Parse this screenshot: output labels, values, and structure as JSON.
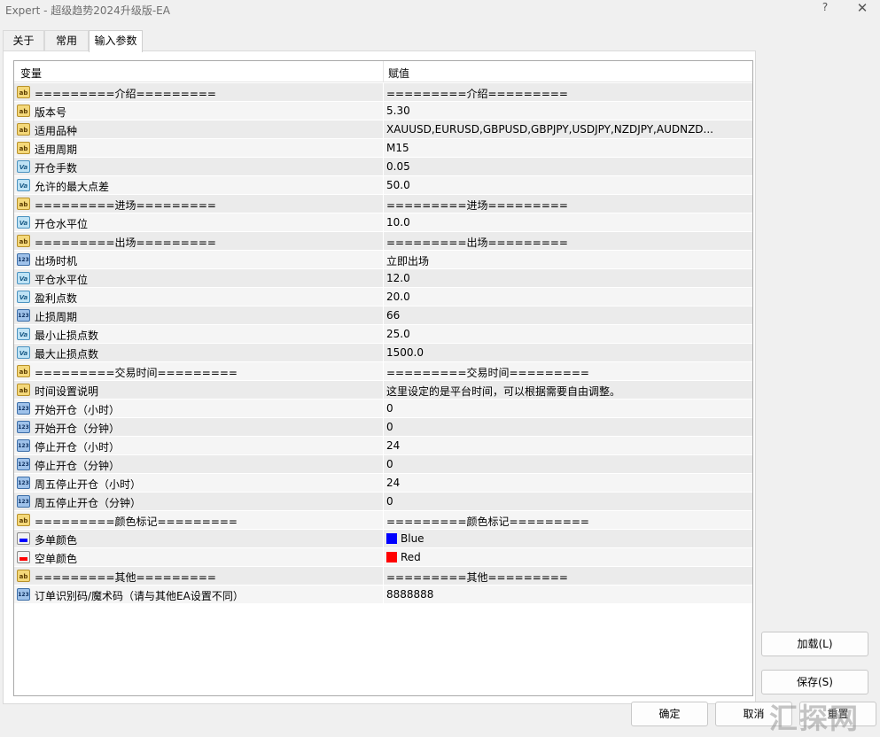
{
  "window": {
    "title": "Expert - 超级趋势2024升级版-EA",
    "help": "?",
    "close": "✕"
  },
  "tabs": [
    {
      "label": "关于",
      "active": false
    },
    {
      "label": "常用",
      "active": false
    },
    {
      "label": "输入参数",
      "active": true
    }
  ],
  "table": {
    "headers": {
      "variable": "变量",
      "value": "赋值"
    },
    "rows": [
      {
        "icon": "ab",
        "name": "=========介绍=========",
        "value": "=========介绍========="
      },
      {
        "icon": "ab",
        "name": "版本号",
        "value": "5.30"
      },
      {
        "icon": "ab",
        "name": "适用品种",
        "value": "XAUUSD,EURUSD,GBPUSD,GBPJPY,USDJPY,NZDJPY,AUDNZD..."
      },
      {
        "icon": "ab",
        "name": "适用周期",
        "value": "M15"
      },
      {
        "icon": "va",
        "name": "开仓手数",
        "value": "0.05"
      },
      {
        "icon": "va",
        "name": "允许的最大点差",
        "value": "50.0"
      },
      {
        "icon": "ab",
        "name": "=========进场=========",
        "value": "=========进场========="
      },
      {
        "icon": "va",
        "name": "开仓水平位",
        "value": "10.0"
      },
      {
        "icon": "ab",
        "name": "=========出场=========",
        "value": "=========出场========="
      },
      {
        "icon": "n123",
        "name": "出场时机",
        "value": "立即出场"
      },
      {
        "icon": "va",
        "name": "平仓水平位",
        "value": "12.0"
      },
      {
        "icon": "va",
        "name": "盈利点数",
        "value": "20.0"
      },
      {
        "icon": "n123",
        "name": "止损周期",
        "value": "66"
      },
      {
        "icon": "va",
        "name": "最小止损点数",
        "value": "25.0"
      },
      {
        "icon": "va",
        "name": "最大止损点数",
        "value": "1500.0"
      },
      {
        "icon": "ab",
        "name": "=========交易时间=========",
        "value": "=========交易时间========="
      },
      {
        "icon": "ab",
        "name": "时间设置说明",
        "value": "这里设定的是平台时间，可以根据需要自由调整。"
      },
      {
        "icon": "n123",
        "name": "开始开仓（小时）",
        "value": "0"
      },
      {
        "icon": "n123",
        "name": "开始开仓（分钟）",
        "value": "0"
      },
      {
        "icon": "n123",
        "name": "停止开仓（小时）",
        "value": "24"
      },
      {
        "icon": "n123",
        "name": "停止开仓（分钟）",
        "value": "0"
      },
      {
        "icon": "n123",
        "name": "周五停止开仓（小时）",
        "value": "24"
      },
      {
        "icon": "n123",
        "name": "周五停止开仓（分钟）",
        "value": "0"
      },
      {
        "icon": "ab",
        "name": "=========颜色标记=========",
        "value": "=========颜色标记========="
      },
      {
        "icon": "clr",
        "name": "多单颜色",
        "value": "Blue",
        "color": "#0000ff"
      },
      {
        "icon": "clr",
        "name": "空单颜色",
        "value": "Red",
        "color": "#ff0000"
      },
      {
        "icon": "ab",
        "name": "=========其他=========",
        "value": "=========其他========="
      },
      {
        "icon": "n123",
        "name": "订单识别码/魔术码（请与其他EA设置不同）",
        "value": "8888888"
      }
    ]
  },
  "buttons": {
    "load": "加载(L)",
    "save": "保存(S)",
    "ok": "确定",
    "cancel": "取消",
    "reset": "重置"
  },
  "icon_labels": {
    "ab": "ab",
    "va": "Va",
    "n123": "123"
  },
  "watermark": "汇探网"
}
